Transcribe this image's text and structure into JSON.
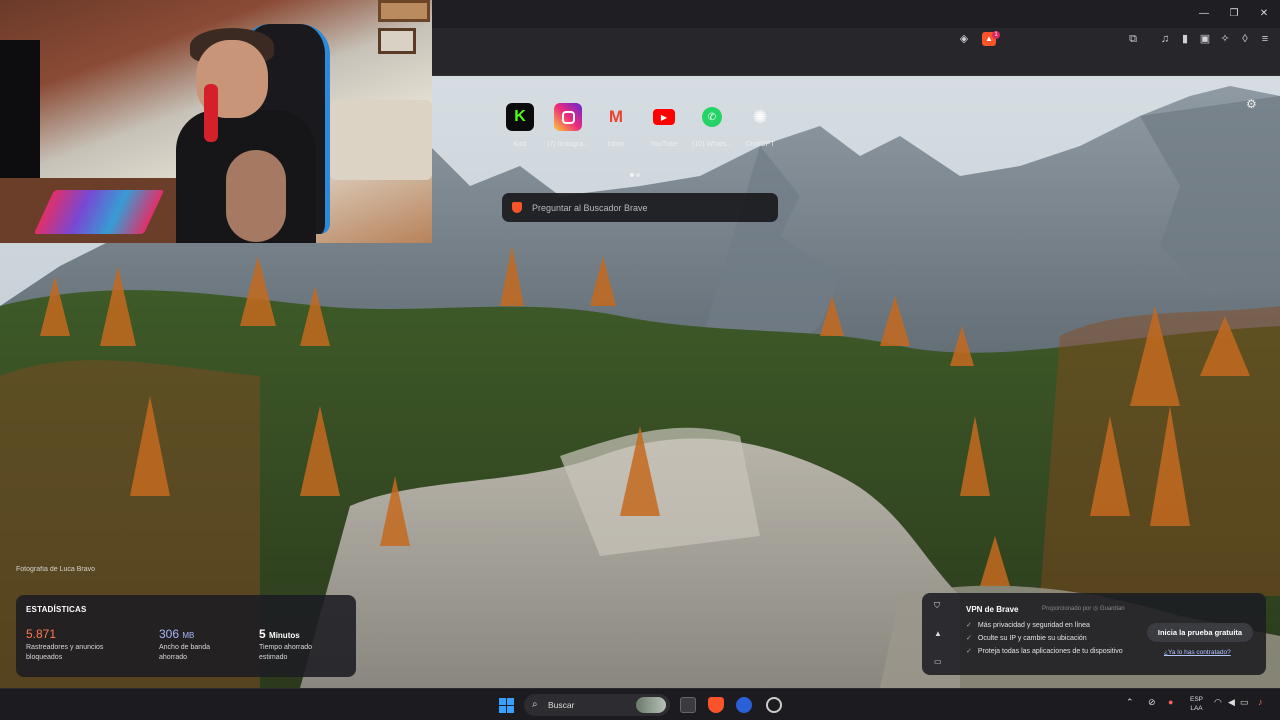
{
  "window": {
    "controls": {
      "minimize": "—",
      "restore": "❐",
      "close": "✕"
    }
  },
  "toolbar": {
    "icons": [
      "shield-icon",
      "rewards-icon",
      "screenshot-icon",
      "music-icon",
      "sidebar-icon",
      "wallet-icon",
      "leo-icon",
      "vpn-icon",
      "menu-icon"
    ],
    "rewards_badge": "1"
  },
  "speed_dial": [
    {
      "label": "Kick",
      "icon": "kick-icon",
      "color": "#53fc18"
    },
    {
      "label": "(7) Instagra...",
      "icon": "instagram-icon",
      "color": "#e1306c"
    },
    {
      "label": "Inbox",
      "icon": "gmail-icon",
      "color": "#ea4335"
    },
    {
      "label": "YouTube",
      "icon": "youtube-icon",
      "color": "#ff0000"
    },
    {
      "label": "(10) Whats...",
      "icon": "whatsapp-icon",
      "color": "#25d366"
    },
    {
      "label": "ChatGPT",
      "icon": "chatgpt-icon",
      "color": "#ffffff"
    }
  ],
  "search": {
    "placeholder": "Preguntar al Buscador Brave"
  },
  "photo_credit": "Fotografía de Luca Bravo",
  "stats": {
    "title": "ESTADÍSTICAS",
    "trackers": {
      "value": "5.871",
      "desc1": "Rastreadores y anuncios",
      "desc2": "bloqueados",
      "color": "#ff7a4d"
    },
    "bandwidth": {
      "value": "306",
      "unit": "MB",
      "desc1": "Ancho de banda",
      "desc2": "ahorrado",
      "color": "#a8b5ff"
    },
    "time": {
      "value": "5",
      "unit": "Minutos",
      "desc1": "Tiempo ahorrado",
      "desc2": "estimado",
      "color": "#ffffff"
    }
  },
  "vpn": {
    "title": "VPN de Brave",
    "provided_by": "Proporcionado por ◎ Guardian",
    "features": [
      "Más privacidad y seguridad en línea",
      "Oculte su IP y cambie su ubicación",
      "Proteja todas las aplicaciones de tu dispositivo"
    ],
    "cta": "Inicia la prueba gratuita",
    "already": "¿Ya lo has contratado?"
  },
  "taskbar": {
    "search_label": "Buscar",
    "lang_line1": "ESP",
    "lang_line2": "LAA"
  }
}
